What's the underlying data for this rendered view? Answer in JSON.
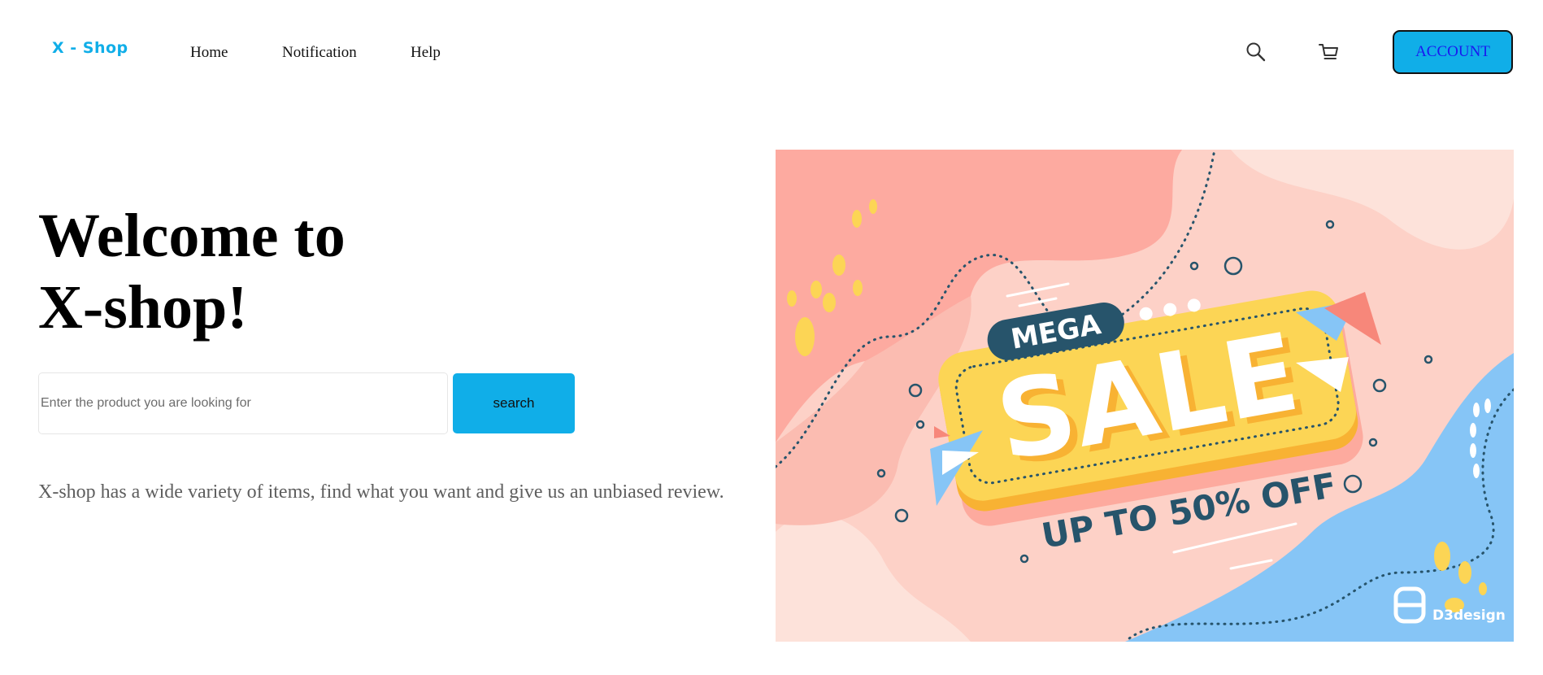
{
  "header": {
    "logo": "X - Shop",
    "nav": [
      "Home",
      "Notification",
      "Help"
    ],
    "account_label": "ACCOUNT",
    "icons": {
      "search": "search-icon",
      "cart": "cart-icon"
    }
  },
  "hero": {
    "title_line1": "Welcome to",
    "title_line2": "X-shop!",
    "search_placeholder": "Enter the product you are looking for",
    "search_button": "search",
    "tagline": "X-shop has a wide variety of items, find what you want and give us an unbiased review."
  },
  "banner": {
    "badge": "MEGA",
    "headline": "SALE",
    "subline": "UP TO 50%  OFF",
    "brand": "D3design"
  },
  "colors": {
    "accent": "#10aee8",
    "account_text": "#1a18f0",
    "banner_bg": "#fdd1c7",
    "banner_yellow": "#fcd555",
    "banner_navy": "#27546b",
    "banner_blue": "#86c5f6"
  }
}
